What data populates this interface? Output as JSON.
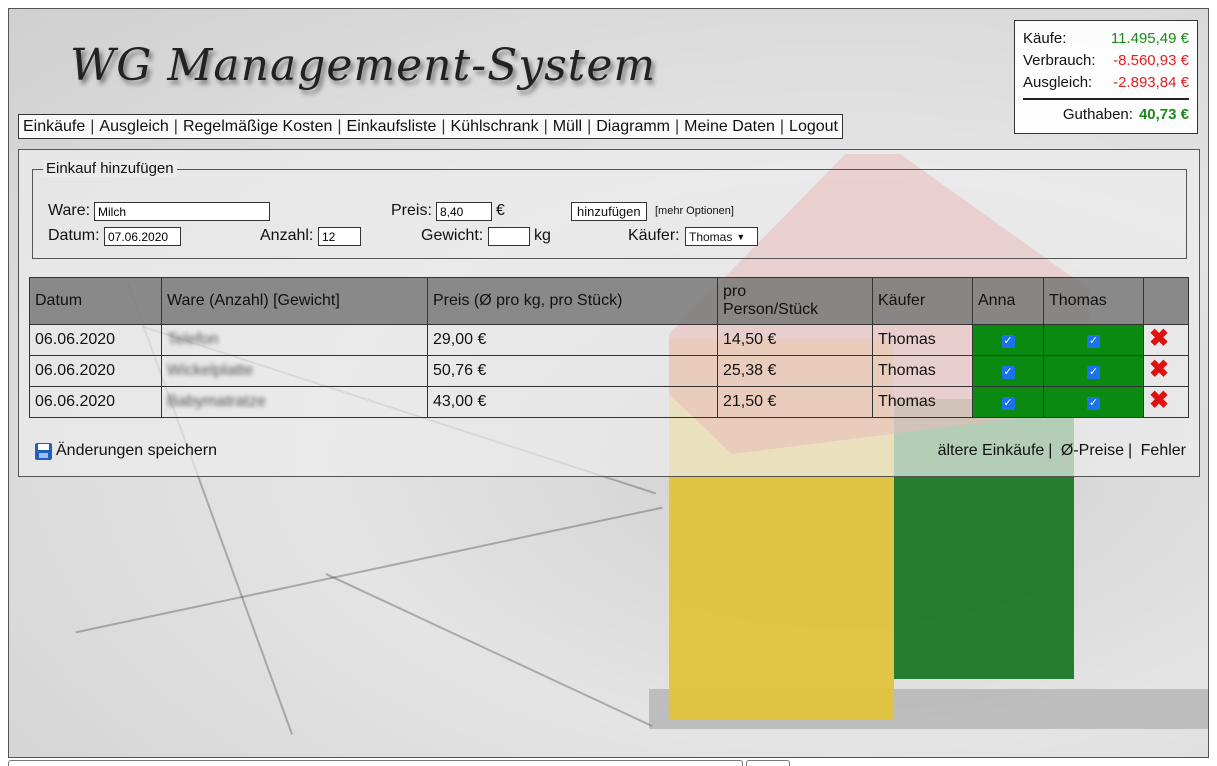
{
  "app": {
    "title": "WG Management-System"
  },
  "nav": {
    "items": [
      "Einkäufe",
      "Ausgleich",
      "Regelmäßige Kosten",
      "Einkaufsliste",
      "Kühlschrank",
      "Müll",
      "Diagramm",
      "Meine Daten",
      "Logout"
    ]
  },
  "summary": {
    "kaeufe_label": "Käufe:",
    "kaeufe_value": "11.495,49 €",
    "verbrauch_label": "Verbrauch:",
    "verbrauch_value": "-8.560,93 €",
    "ausgleich_label": "Ausgleich:",
    "ausgleich_value": "-2.893,84 €",
    "guthaben_label": "Guthaben:",
    "guthaben_value": "40,73 €",
    "colors": {
      "positive": "#1a8a1a",
      "negative": "#e02020"
    }
  },
  "form": {
    "legend": "Einkauf hinzufügen",
    "ware_label": "Ware:",
    "ware_value": "Milch",
    "preis_label": "Preis:",
    "preis_value": "8,40",
    "preis_unit": "€",
    "add_button": "hinzufügen",
    "more_options": "[mehr Optionen]",
    "datum_label": "Datum:",
    "datum_value": "07.06.2020",
    "anzahl_label": "Anzahl:",
    "anzahl_value": "12",
    "gewicht_label": "Gewicht:",
    "gewicht_value": "",
    "gewicht_unit": "kg",
    "kaeufer_label": "Käufer:",
    "kaeufer_value": "Thomas"
  },
  "table": {
    "headers": {
      "datum": "Datum",
      "ware": "Ware (Anzahl) [Gewicht]",
      "preis": "Preis (Ø pro kg, pro Stück)",
      "pro_line1": "pro",
      "pro_line2": "Person/Stück",
      "kaeufer": "Käufer",
      "anna": "Anna",
      "thomas": "Thomas"
    },
    "rows": [
      {
        "datum": "06.06.2020",
        "ware": "Telefon",
        "preis": "29,00 €",
        "pro": "14,50 €",
        "kaeufer": "Thomas",
        "anna": true,
        "thomas": true
      },
      {
        "datum": "06.06.2020",
        "ware": "Wickelplatte",
        "preis": "50,76 €",
        "pro": "25,38 €",
        "kaeufer": "Thomas",
        "anna": true,
        "thomas": true
      },
      {
        "datum": "06.06.2020",
        "ware": "Babymatratze",
        "preis": "43,00 €",
        "pro": "21,50 €",
        "kaeufer": "Thomas",
        "anna": true,
        "thomas": true
      }
    ],
    "checkbox_color": "#0a8a10",
    "delete_icon": "red-x-icon"
  },
  "footer": {
    "save_label": "Änderungen speichern",
    "links": [
      "ältere Einkäufe",
      "Ø-Preise",
      "Fehler"
    ]
  }
}
